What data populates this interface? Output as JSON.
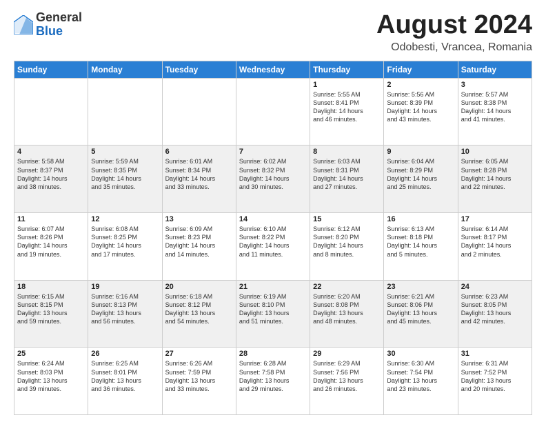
{
  "header": {
    "logo_general": "General",
    "logo_blue": "Blue",
    "month_title": "August 2024",
    "location": "Odobesti, Vrancea, Romania"
  },
  "days_of_week": [
    "Sunday",
    "Monday",
    "Tuesday",
    "Wednesday",
    "Thursday",
    "Friday",
    "Saturday"
  ],
  "weeks": [
    [
      {
        "day": "",
        "info": ""
      },
      {
        "day": "",
        "info": ""
      },
      {
        "day": "",
        "info": ""
      },
      {
        "day": "",
        "info": ""
      },
      {
        "day": "1",
        "info": "Sunrise: 5:55 AM\nSunset: 8:41 PM\nDaylight: 14 hours\nand 46 minutes."
      },
      {
        "day": "2",
        "info": "Sunrise: 5:56 AM\nSunset: 8:39 PM\nDaylight: 14 hours\nand 43 minutes."
      },
      {
        "day": "3",
        "info": "Sunrise: 5:57 AM\nSunset: 8:38 PM\nDaylight: 14 hours\nand 41 minutes."
      }
    ],
    [
      {
        "day": "4",
        "info": "Sunrise: 5:58 AM\nSunset: 8:37 PM\nDaylight: 14 hours\nand 38 minutes."
      },
      {
        "day": "5",
        "info": "Sunrise: 5:59 AM\nSunset: 8:35 PM\nDaylight: 14 hours\nand 35 minutes."
      },
      {
        "day": "6",
        "info": "Sunrise: 6:01 AM\nSunset: 8:34 PM\nDaylight: 14 hours\nand 33 minutes."
      },
      {
        "day": "7",
        "info": "Sunrise: 6:02 AM\nSunset: 8:32 PM\nDaylight: 14 hours\nand 30 minutes."
      },
      {
        "day": "8",
        "info": "Sunrise: 6:03 AM\nSunset: 8:31 PM\nDaylight: 14 hours\nand 27 minutes."
      },
      {
        "day": "9",
        "info": "Sunrise: 6:04 AM\nSunset: 8:29 PM\nDaylight: 14 hours\nand 25 minutes."
      },
      {
        "day": "10",
        "info": "Sunrise: 6:05 AM\nSunset: 8:28 PM\nDaylight: 14 hours\nand 22 minutes."
      }
    ],
    [
      {
        "day": "11",
        "info": "Sunrise: 6:07 AM\nSunset: 8:26 PM\nDaylight: 14 hours\nand 19 minutes."
      },
      {
        "day": "12",
        "info": "Sunrise: 6:08 AM\nSunset: 8:25 PM\nDaylight: 14 hours\nand 17 minutes."
      },
      {
        "day": "13",
        "info": "Sunrise: 6:09 AM\nSunset: 8:23 PM\nDaylight: 14 hours\nand 14 minutes."
      },
      {
        "day": "14",
        "info": "Sunrise: 6:10 AM\nSunset: 8:22 PM\nDaylight: 14 hours\nand 11 minutes."
      },
      {
        "day": "15",
        "info": "Sunrise: 6:12 AM\nSunset: 8:20 PM\nDaylight: 14 hours\nand 8 minutes."
      },
      {
        "day": "16",
        "info": "Sunrise: 6:13 AM\nSunset: 8:18 PM\nDaylight: 14 hours\nand 5 minutes."
      },
      {
        "day": "17",
        "info": "Sunrise: 6:14 AM\nSunset: 8:17 PM\nDaylight: 14 hours\nand 2 minutes."
      }
    ],
    [
      {
        "day": "18",
        "info": "Sunrise: 6:15 AM\nSunset: 8:15 PM\nDaylight: 13 hours\nand 59 minutes."
      },
      {
        "day": "19",
        "info": "Sunrise: 6:16 AM\nSunset: 8:13 PM\nDaylight: 13 hours\nand 56 minutes."
      },
      {
        "day": "20",
        "info": "Sunrise: 6:18 AM\nSunset: 8:12 PM\nDaylight: 13 hours\nand 54 minutes."
      },
      {
        "day": "21",
        "info": "Sunrise: 6:19 AM\nSunset: 8:10 PM\nDaylight: 13 hours\nand 51 minutes."
      },
      {
        "day": "22",
        "info": "Sunrise: 6:20 AM\nSunset: 8:08 PM\nDaylight: 13 hours\nand 48 minutes."
      },
      {
        "day": "23",
        "info": "Sunrise: 6:21 AM\nSunset: 8:06 PM\nDaylight: 13 hours\nand 45 minutes."
      },
      {
        "day": "24",
        "info": "Sunrise: 6:23 AM\nSunset: 8:05 PM\nDaylight: 13 hours\nand 42 minutes."
      }
    ],
    [
      {
        "day": "25",
        "info": "Sunrise: 6:24 AM\nSunset: 8:03 PM\nDaylight: 13 hours\nand 39 minutes."
      },
      {
        "day": "26",
        "info": "Sunrise: 6:25 AM\nSunset: 8:01 PM\nDaylight: 13 hours\nand 36 minutes."
      },
      {
        "day": "27",
        "info": "Sunrise: 6:26 AM\nSunset: 7:59 PM\nDaylight: 13 hours\nand 33 minutes."
      },
      {
        "day": "28",
        "info": "Sunrise: 6:28 AM\nSunset: 7:58 PM\nDaylight: 13 hours\nand 29 minutes."
      },
      {
        "day": "29",
        "info": "Sunrise: 6:29 AM\nSunset: 7:56 PM\nDaylight: 13 hours\nand 26 minutes."
      },
      {
        "day": "30",
        "info": "Sunrise: 6:30 AM\nSunset: 7:54 PM\nDaylight: 13 hours\nand 23 minutes."
      },
      {
        "day": "31",
        "info": "Sunrise: 6:31 AM\nSunset: 7:52 PM\nDaylight: 13 hours\nand 20 minutes."
      }
    ]
  ]
}
